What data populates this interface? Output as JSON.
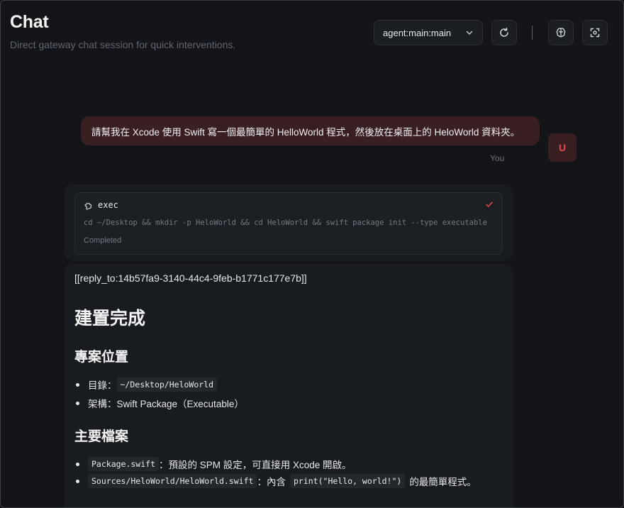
{
  "header": {
    "title": "Chat",
    "subtitle": "Direct gateway chat session for quick interventions."
  },
  "toolbar": {
    "session_value": "agent:main:main",
    "icons": [
      "chevron-down-icon",
      "refresh-icon",
      "brain-icon",
      "focus-icon"
    ]
  },
  "user_message": {
    "text": "請幫我在 Xcode 使用 Swift 寫一個最簡單的 HelloWorld 程式，然後放在桌面上的 HeloWorld 資料夾。",
    "avatar": "U",
    "label": "You"
  },
  "tool_call": {
    "name": "exec",
    "command": "cd ~/Desktop && mkdir -p HeloWorld && cd HeloWorld && swift package init --type executable",
    "status": "Completed"
  },
  "reply": {
    "tag": "[[reply_to:14b57fa9-3140-44c4-9feb-b1771c177e7b]]",
    "heading": "建置完成",
    "section1": {
      "title": "專案位置",
      "item1_label": "目錄：",
      "item1_code": "~/Desktop/HeloWorld",
      "item2_text": "架構：Swift Package（Executable）"
    },
    "section2": {
      "title": "主要檔案",
      "item1_code": "Package.swift",
      "item1_text": "：預設的 SPM 設定，可直接用 Xcode 開啟。",
      "item2_code": "Sources/HeloWorld/HeloWorld.swift",
      "item2_text_a": "：內含",
      "item2_code2": "print(\"Hello, world!\")",
      "item2_text_b": "的最簡單程式。"
    }
  },
  "colors": {
    "background": "#131518",
    "user_bubble": "#3a1f22",
    "accent_red": "#e5484d"
  }
}
